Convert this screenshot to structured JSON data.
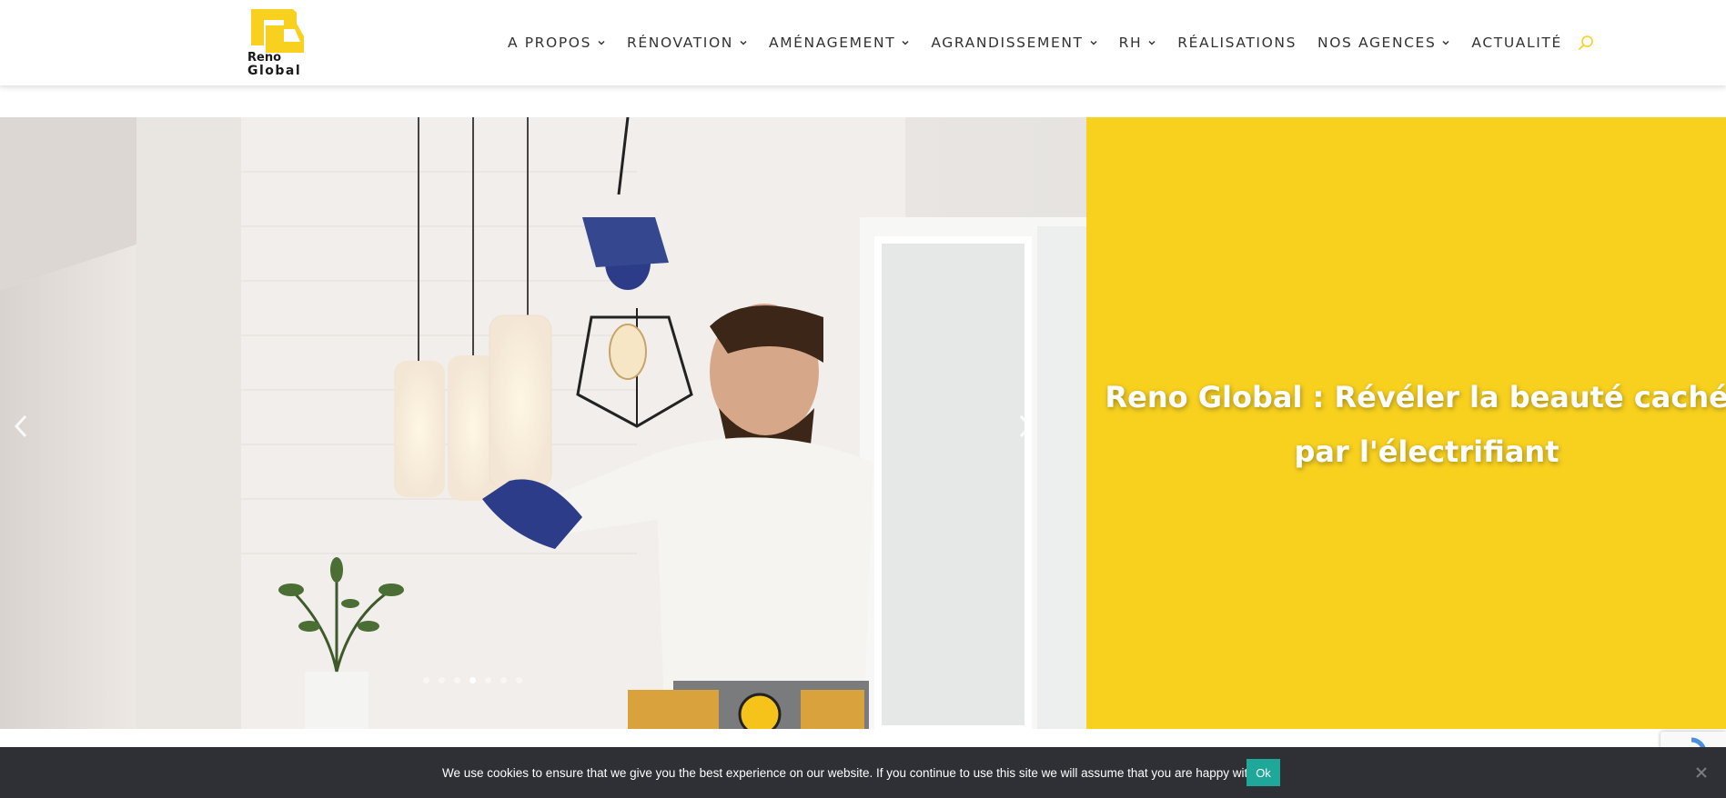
{
  "header": {
    "logo": {
      "line1": "Reno",
      "line2": "Global",
      "icon": "reno-global-logo"
    },
    "nav": [
      {
        "label": "A PROPOS",
        "has_dropdown": true
      },
      {
        "label": "RÉNOVATION",
        "has_dropdown": true
      },
      {
        "label": "AMÉNAGEMENT",
        "has_dropdown": true
      },
      {
        "label": "AGRANDISSEMENT",
        "has_dropdown": true
      },
      {
        "label": "RH",
        "has_dropdown": true
      },
      {
        "label": "RÉALISATIONS",
        "has_dropdown": false
      },
      {
        "label": "NOS AGENCES",
        "has_dropdown": true
      },
      {
        "label": "ACTUALITÉ",
        "has_dropdown": false
      }
    ],
    "search_icon": "search-icon"
  },
  "hero": {
    "headline_line1": "Reno Global : Révéler la beauté cachée",
    "headline_line2": "par l'électrifiant",
    "image_subject": "electrician installing pendant light",
    "slide_count": 7,
    "active_slide": 4
  },
  "cookie": {
    "text": "We use cookies to ensure that we give you the best experience on our website. If you continue to use this site we will assume that you are happy with it.",
    "ok_label": "Ok"
  },
  "colors": {
    "accent_yellow": "#f8d11f",
    "cookie_bg": "#2e3035",
    "ok_button": "#1fa89a",
    "nav_text": "#333333"
  }
}
